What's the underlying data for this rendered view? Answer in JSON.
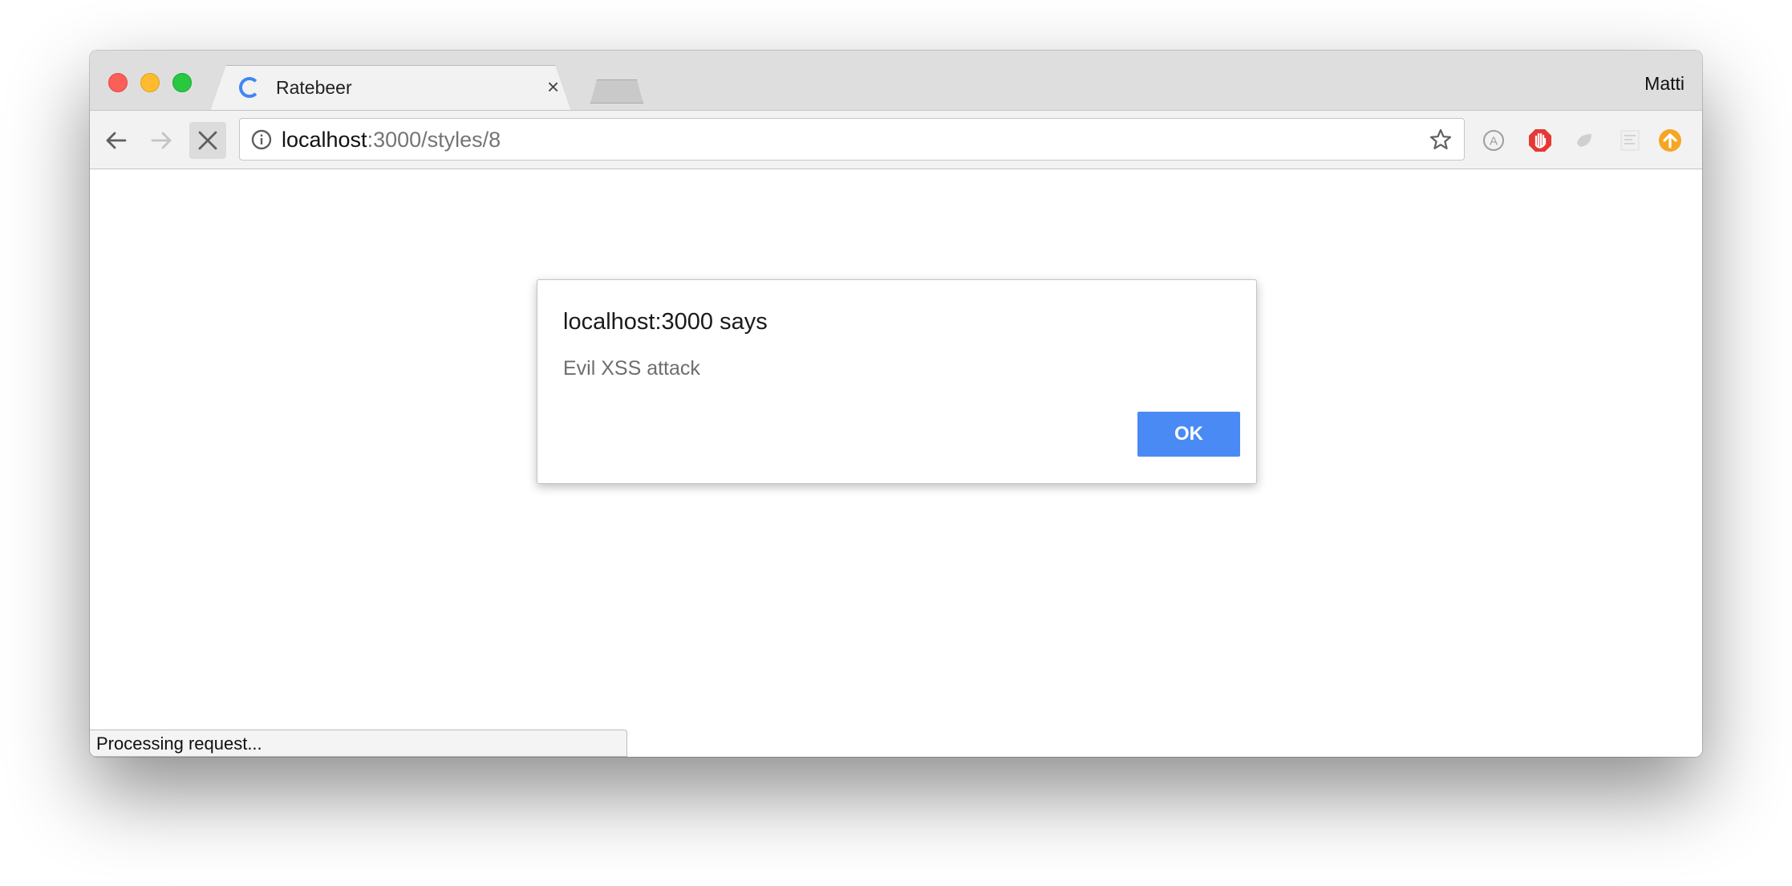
{
  "window": {
    "tab_title": "Ratebeer",
    "tab_close": "×",
    "profile_name": "Matti"
  },
  "toolbar": {
    "url_host": "localhost",
    "url_rest": ":3000/styles/8"
  },
  "dialog": {
    "title": "localhost:3000 says",
    "message": "Evil XSS attack",
    "ok_label": "OK"
  },
  "status": {
    "text": "Processing request..."
  },
  "colors": {
    "accent": "#4a8af4",
    "close": "#fc5f57",
    "minimize": "#fdbc2e",
    "maximize": "#28c840",
    "ext_adblock": "#e53935",
    "ext_update": "#f5a623"
  },
  "icons": {
    "back": "arrow-left-icon",
    "forward": "arrow-right-icon",
    "stop": "close-x-icon",
    "info": "info-icon",
    "bookmark": "star-icon",
    "loading": "spinner-icon"
  }
}
